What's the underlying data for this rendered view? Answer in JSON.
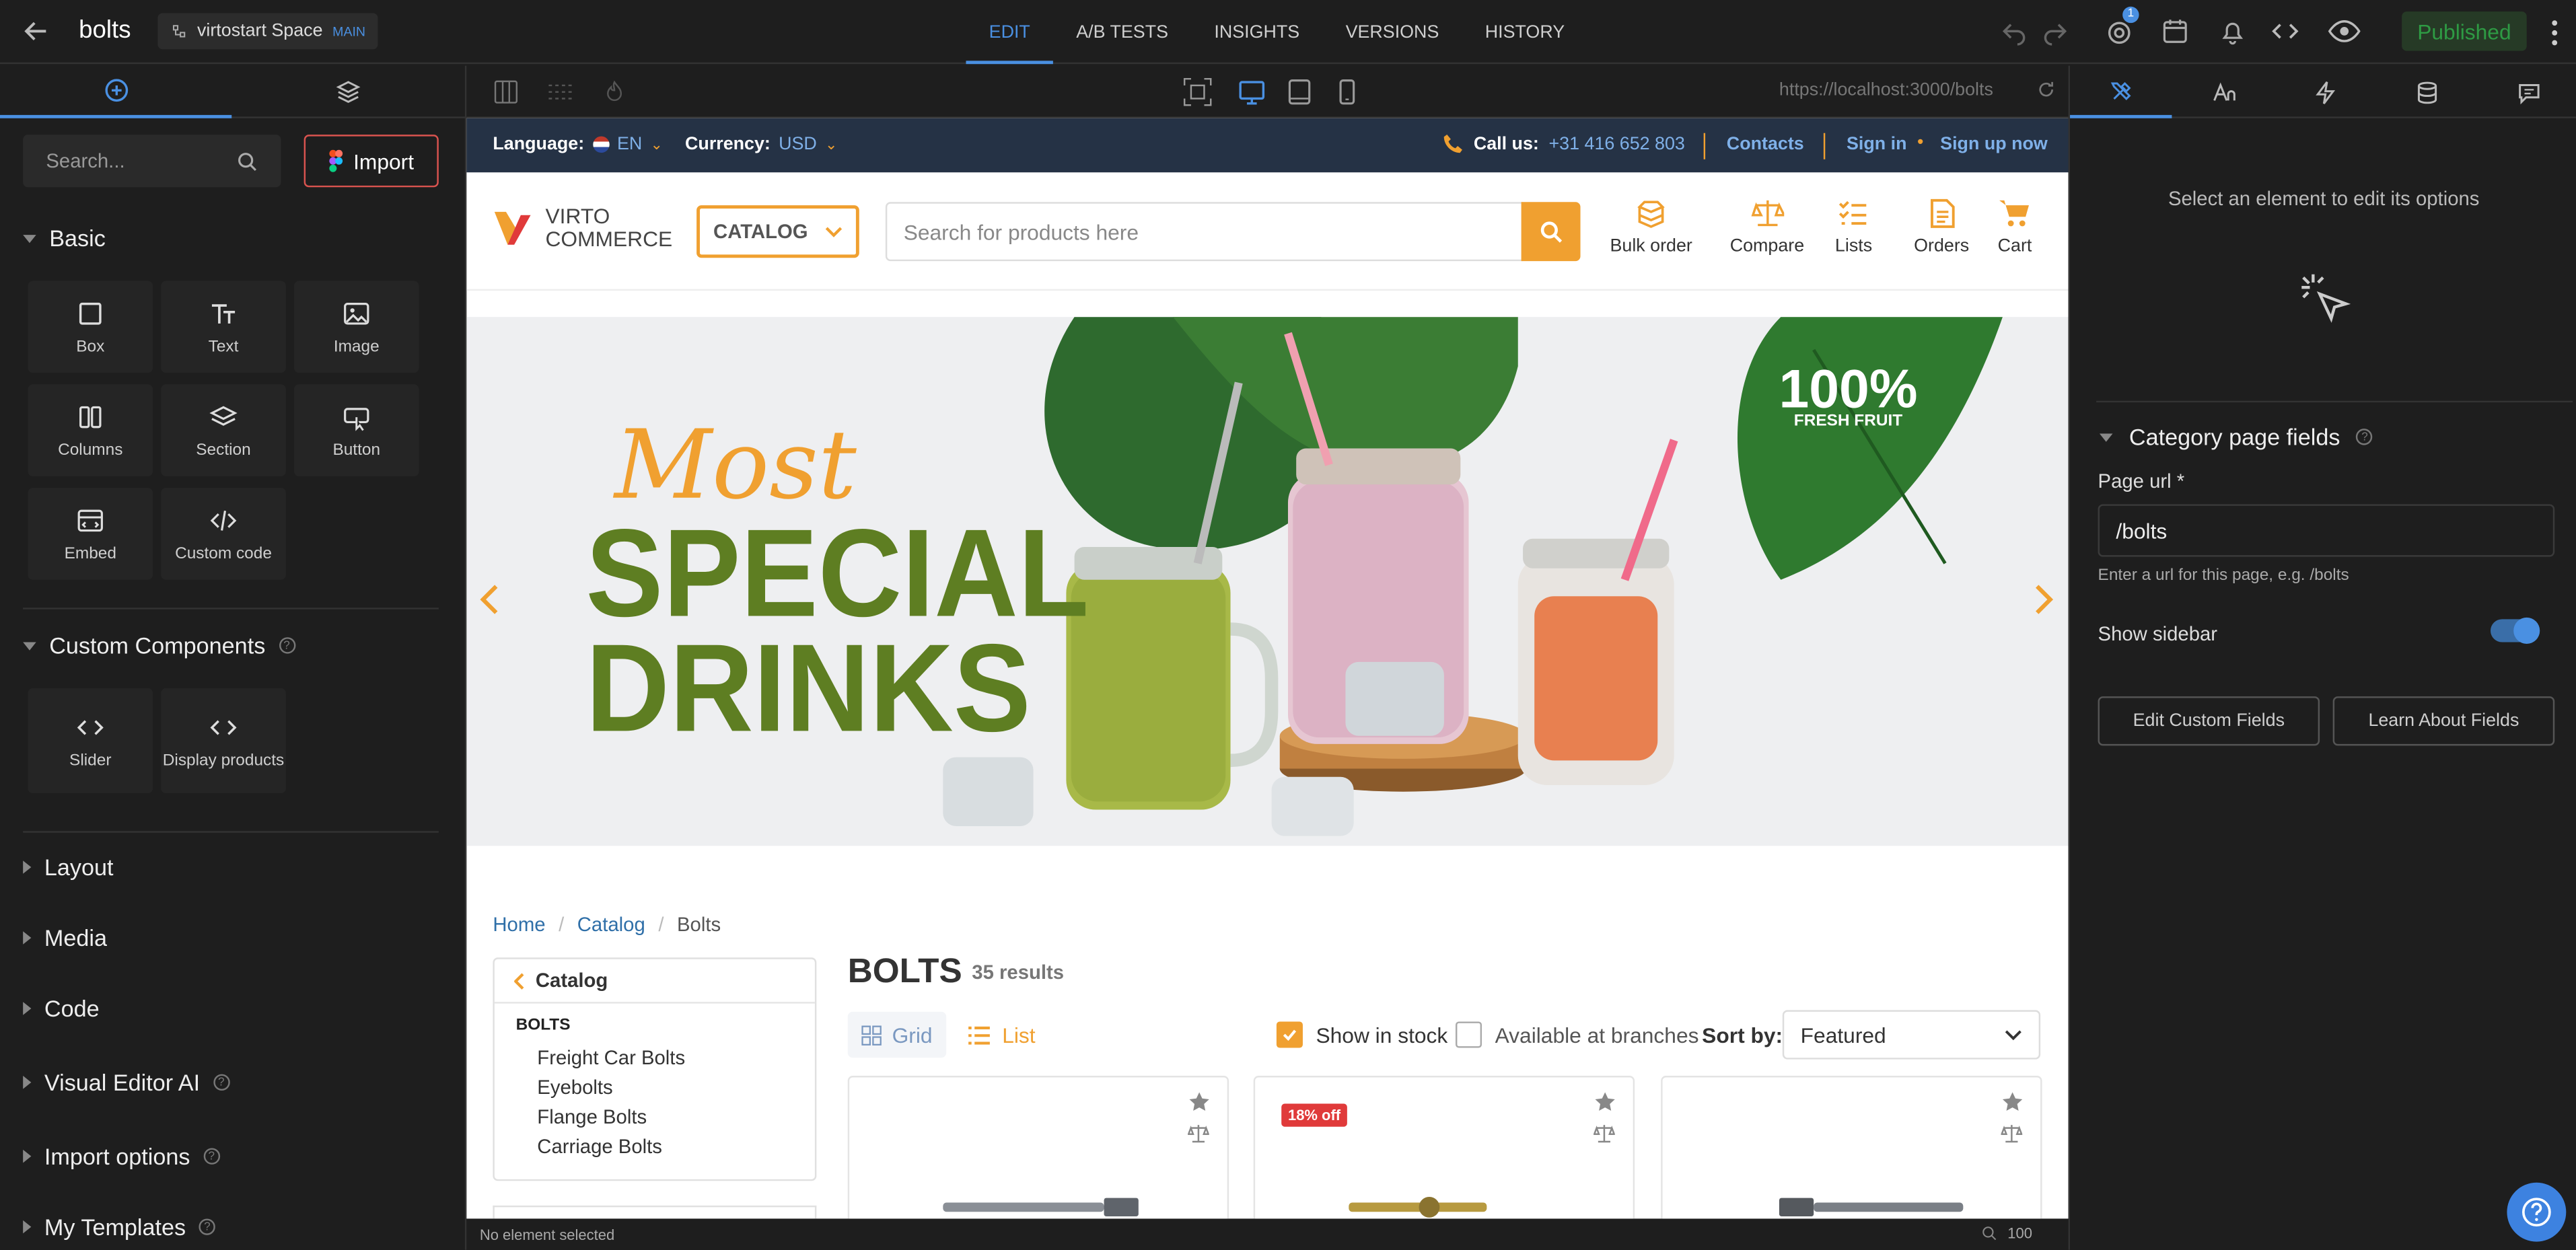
{
  "topbar": {
    "page_title": "bolts",
    "space_name": "virtostart Space",
    "space_tag": "MAIN",
    "tabs": [
      "EDIT",
      "A/B TESTS",
      "INSIGHTS",
      "VERSIONS",
      "HISTORY"
    ],
    "notification_count": "1",
    "published_label": "Published",
    "accent": "#4a90e2"
  },
  "left_panel": {
    "search_placeholder": "Search...",
    "import_label": "Import",
    "basic_label": "Basic",
    "basic_blocks": [
      "Box",
      "Text",
      "Image",
      "Columns",
      "Section",
      "Button",
      "Embed",
      "Custom code"
    ],
    "custom_components_label": "Custom Components",
    "custom_blocks": [
      "Slider",
      "Display products"
    ],
    "collapsed_sections": [
      "Layout",
      "Media",
      "Code",
      "Visual Editor AI",
      "Import options",
      "My Templates"
    ]
  },
  "canvas": {
    "url": "https://localhost:3000/bolts",
    "status_text": "No element selected",
    "zoom": "100"
  },
  "site": {
    "language_label": "Language:",
    "language_value": "EN",
    "currency_label": "Currency:",
    "currency_value": "USD",
    "call_label": "Call us:",
    "phone": "+31 416 652 803",
    "contacts": "Contacts",
    "sign_in": "Sign in",
    "sign_up": "Sign up now",
    "logo_line1": "VIRTO",
    "logo_line2": "COMMERCE",
    "catalog_btn": "CATALOG",
    "search_placeholder": "Search for products here",
    "header_icons": [
      "Bulk order",
      "Compare",
      "Lists",
      "Orders",
      "Cart"
    ],
    "banner": {
      "script_text": "Most",
      "line1": "SPECIAL",
      "line2": "DRINKS",
      "badge_big": "100%",
      "badge_small": "FRESH FRUIT"
    },
    "breadcrumbs": [
      "Home",
      "Catalog",
      "Bolts"
    ],
    "sidebar_back": "Catalog",
    "sidebar_current": "BOLTS",
    "sidebar_items": [
      "Freight Car Bolts",
      "Eyebolts",
      "Flange Bolts",
      "Carriage Bolts"
    ],
    "page_heading": "BOLTS",
    "results": "35 results",
    "view_grid": "Grid",
    "view_list": "List",
    "show_in_stock": "Show in stock",
    "available_at_branches": "Available at branches",
    "sort_label": "Sort by:",
    "sort_value": "Featured",
    "discount_badge": "18% off"
  },
  "right_panel": {
    "hint": "Select an element to edit its options",
    "section_title": "Category page fields",
    "page_url_label": "Page url *",
    "page_url_value": "/bolts",
    "page_url_help": "Enter a url for this page, e.g. /bolts",
    "show_sidebar_label": "Show sidebar",
    "edit_fields_btn": "Edit Custom Fields",
    "learn_fields_btn": "Learn About Fields"
  }
}
